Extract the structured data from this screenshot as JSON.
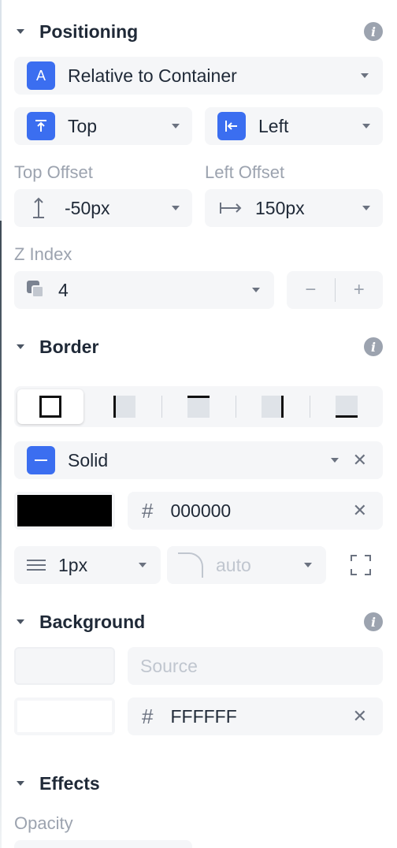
{
  "positioning": {
    "title": "Positioning",
    "mode": {
      "icon_letter": "A",
      "value": "Relative to Container"
    },
    "vertical_anchor": {
      "value": "Top"
    },
    "horizontal_anchor": {
      "value": "Left"
    },
    "top_offset": {
      "label": "Top Offset",
      "value": "-50px"
    },
    "left_offset": {
      "label": "Left Offset",
      "value": "150px"
    },
    "z_index": {
      "label": "Z Index",
      "value": "4",
      "decrement": "−",
      "increment": "+"
    }
  },
  "border": {
    "title": "Border",
    "sides": [
      "all",
      "left",
      "top",
      "right",
      "bottom"
    ],
    "selected_side": "all",
    "style": {
      "value": "Solid"
    },
    "color": {
      "swatch": "#000000",
      "hash": "#",
      "value": "000000"
    },
    "width": {
      "value": "1px"
    },
    "radius": {
      "value": "auto"
    }
  },
  "background": {
    "title": "Background",
    "source_placeholder": "Source",
    "color": {
      "swatch": "#FFFFFF",
      "hash": "#",
      "value": "FFFFFF"
    }
  },
  "effects": {
    "title": "Effects",
    "opacity_label": "Opacity"
  },
  "colors": {
    "accent": "#3b6ef0",
    "field_bg": "#f5f6f8"
  }
}
